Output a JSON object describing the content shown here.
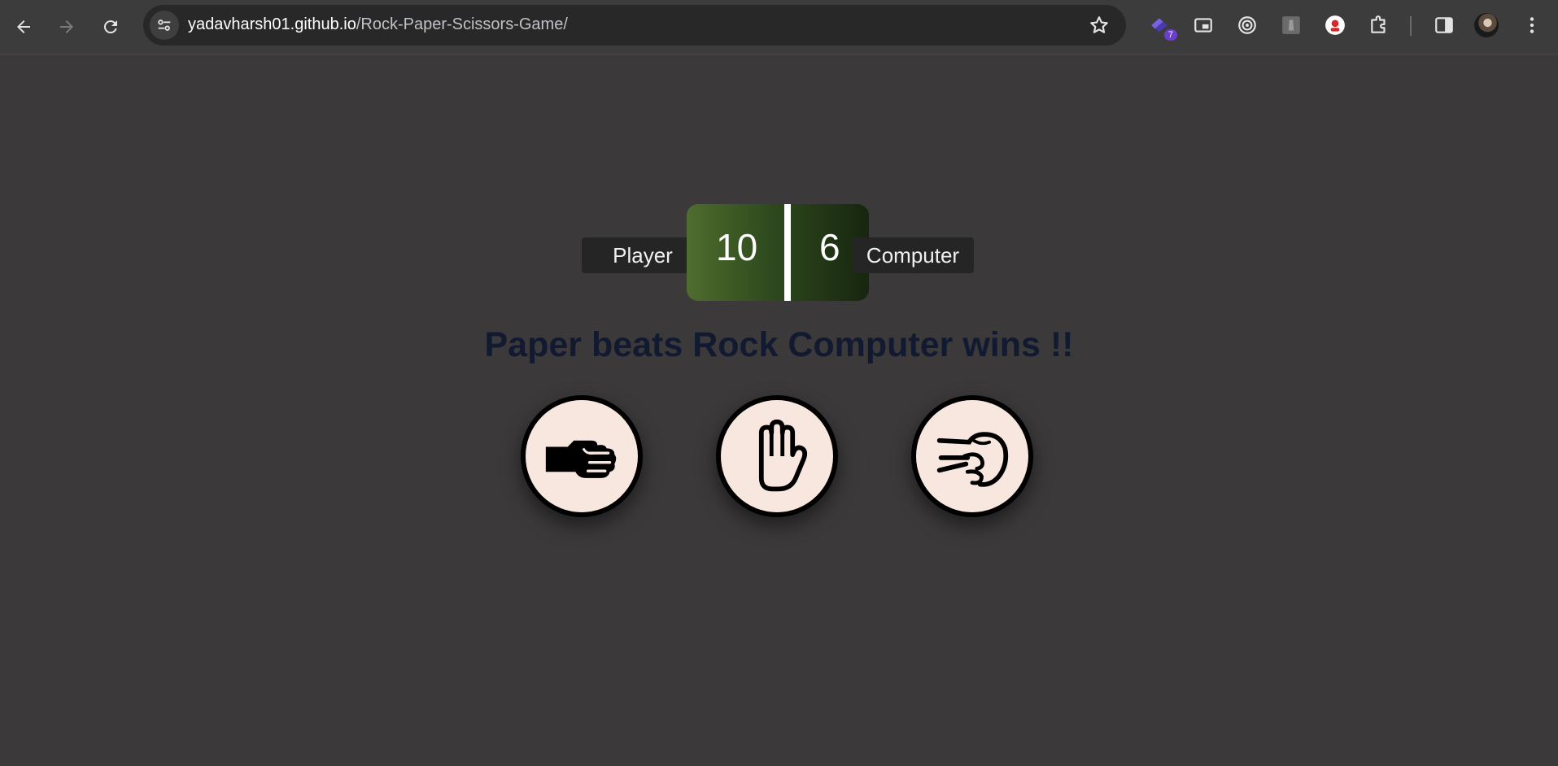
{
  "browser": {
    "url_host": "yadavharsh01.github.io",
    "url_path": "/Rock-Paper-Scissors-Game/",
    "extension_badge": "7",
    "icons": [
      "back-icon",
      "forward-icon",
      "reload-icon",
      "site-settings-icon",
      "bookmark-star-icon",
      "extension-icon",
      "picture-in-picture-icon",
      "target-icon",
      "extension-icon",
      "extension-icon",
      "puzzle-icon",
      "side-panel-icon",
      "profile-avatar",
      "more-menu-icon"
    ]
  },
  "game": {
    "player_label": "Player",
    "computer_label": "Computer",
    "player_score": "10",
    "computer_score": "6",
    "result_message": "Paper beats Rock Computer wins !!",
    "choices": [
      "rock",
      "paper",
      "scissors"
    ]
  },
  "colors": {
    "page_bg": "#3b393a",
    "message": "#111a30",
    "choice_bg": "#f8e7df",
    "scoreboard_left": "#4e6d2e",
    "scoreboard_right": "#17260f"
  }
}
